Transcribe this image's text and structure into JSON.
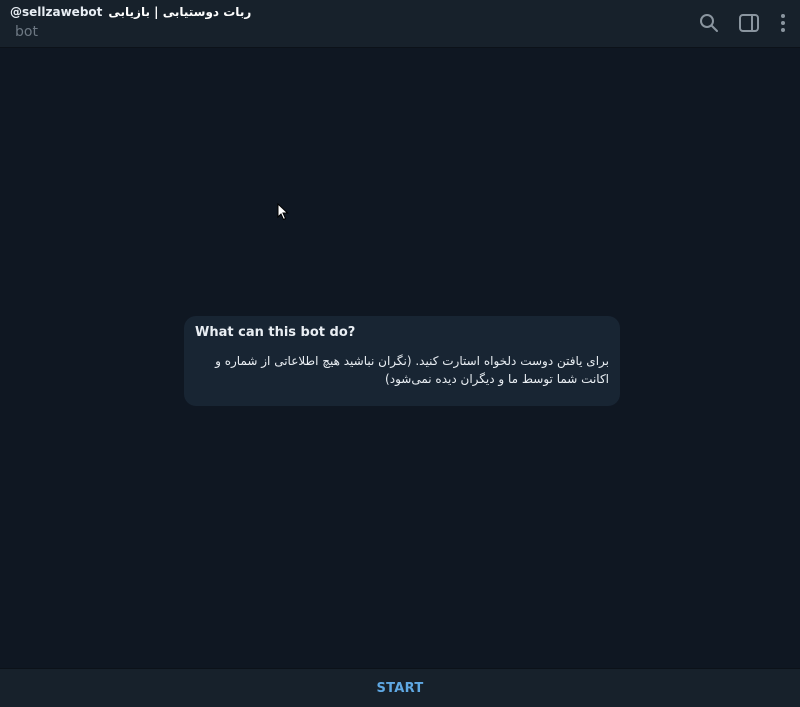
{
  "header": {
    "handle": "@sellzawebot",
    "title": "ربات دوستیابی | بازیابی",
    "subtitle": "bot",
    "icons": [
      "search-icon",
      "sidebar-toggle-icon",
      "more-vertical-icon"
    ]
  },
  "bot_info": {
    "title": "What can this bot do?",
    "description": "برای یافتن دوست دلخواه استارت کنید. (نگران نباشید هیچ اطلاعاتی از شماره و اکانت شما توسط ما و دیگران دیده نمی‌شود)"
  },
  "footer": {
    "start_label": "START"
  },
  "colors": {
    "background": "#0f1722",
    "header": "#17212b",
    "card": "#182533",
    "accent": "#5fa8e3"
  }
}
